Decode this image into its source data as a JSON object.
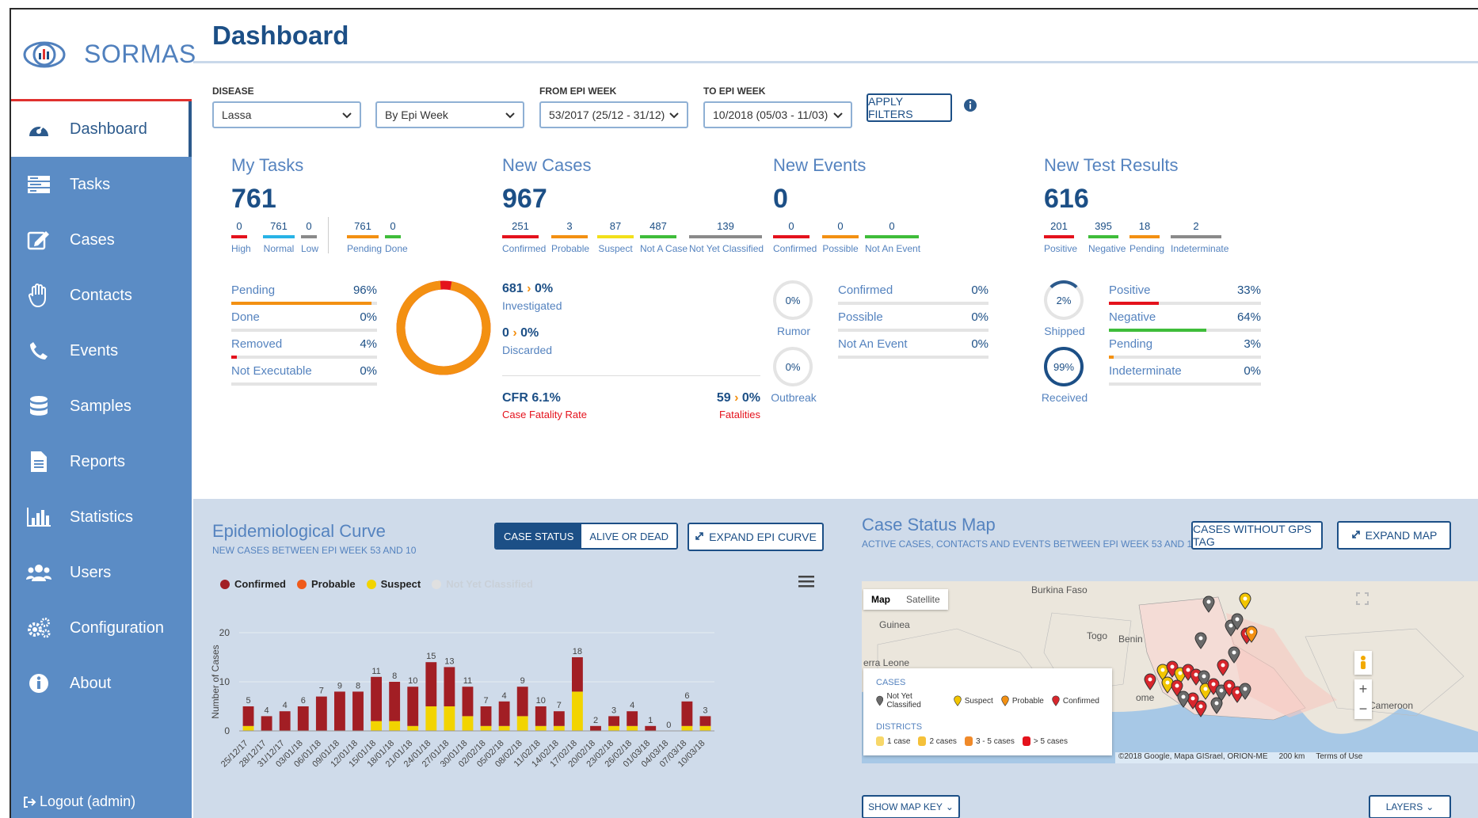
{
  "app": {
    "name": "SORMAS"
  },
  "nav": {
    "items": [
      {
        "label": "Dashboard",
        "icon": "dashboard-icon"
      },
      {
        "label": "Tasks",
        "icon": "tasks-icon"
      },
      {
        "label": "Cases",
        "icon": "edit-icon"
      },
      {
        "label": "Contacts",
        "icon": "hand-icon"
      },
      {
        "label": "Events",
        "icon": "phone-icon"
      },
      {
        "label": "Samples",
        "icon": "database-icon"
      },
      {
        "label": "Reports",
        "icon": "document-icon"
      },
      {
        "label": "Statistics",
        "icon": "bar-chart-icon"
      },
      {
        "label": "Users",
        "icon": "users-icon"
      },
      {
        "label": "Configuration",
        "icon": "gears-icon"
      },
      {
        "label": "About",
        "icon": "info-icon"
      }
    ],
    "logout": "Logout (admin)"
  },
  "header": {
    "title": "Dashboard"
  },
  "filters": {
    "disease_label": "DISEASE",
    "disease_value": "Lassa",
    "grouping_value": "By Epi Week",
    "from_label": "FROM EPI WEEK",
    "from_value": "53/2017 (25/12 - 31/12)",
    "to_label": "TO EPI WEEK",
    "to_value": "10/2018 (05/03 - 11/03)",
    "apply_label": "APPLY FILTERS"
  },
  "tasks": {
    "title": "My Tasks",
    "total": "761",
    "minis": [
      {
        "v": "0",
        "l": "High",
        "c": "#e4121c"
      },
      {
        "v": "761",
        "l": "Normal",
        "c": "#28b3e6"
      },
      {
        "v": "0",
        "l": "Low",
        "c": "#8a8a8a"
      },
      {
        "v": "761",
        "l": "Pending",
        "c": "#f39012"
      },
      {
        "v": "0",
        "l": "Done",
        "c": "#3fbd3a"
      }
    ],
    "progress": [
      {
        "label": "Pending",
        "pct": "96%",
        "fill": 96,
        "c": "#f39012"
      },
      {
        "label": "Done",
        "pct": "0%",
        "fill": 0,
        "c": "#3fbd3a"
      },
      {
        "label": "Removed",
        "pct": "4%",
        "fill": 4,
        "c": "#e4121c"
      },
      {
        "label": "Not Executable",
        "pct": "0%",
        "fill": 0,
        "c": "#8a8a8a"
      }
    ],
    "donut_pending_pct": 96
  },
  "cases": {
    "title": "New Cases",
    "total": "967",
    "minis": [
      {
        "v": "251",
        "l": "Confirmed",
        "c": "#e4121c"
      },
      {
        "v": "3",
        "l": "Probable",
        "c": "#f39012"
      },
      {
        "v": "87",
        "l": "Suspect",
        "c": "#f2e01a"
      },
      {
        "v": "487",
        "l": "Not A Case",
        "c": "#3fbd3a"
      },
      {
        "v": "139",
        "l": "Not Yet Classified",
        "c": "#8a8a8a"
      }
    ],
    "investigated_value": "681",
    "investigated_pct": "0%",
    "investigated_label": "Investigated",
    "discarded_value": "0",
    "discarded_pct": "0%",
    "discarded_label": "Discarded",
    "cfr_value": "CFR 6.1%",
    "cfr_label": "Case Fatality Rate",
    "fatalities_value": "59",
    "fatalities_pct": "0%",
    "fatalities_label": "Fatalities"
  },
  "events": {
    "title": "New Events",
    "total": "0",
    "minis": [
      {
        "v": "0",
        "l": "Confirmed",
        "c": "#e4121c"
      },
      {
        "v": "0",
        "l": "Possible",
        "c": "#f39012"
      },
      {
        "v": "0",
        "l": "Not An Event",
        "c": "#3fbd3a"
      }
    ],
    "rumor_pct": "0%",
    "rumor_label": "Rumor",
    "outbreak_pct": "0%",
    "outbreak_label": "Outbreak",
    "progress": [
      {
        "label": "Confirmed",
        "pct": "0%",
        "fill": 0,
        "c": "#e4121c"
      },
      {
        "label": "Possible",
        "pct": "0%",
        "fill": 0,
        "c": "#f39012"
      },
      {
        "label": "Not An Event",
        "pct": "0%",
        "fill": 0,
        "c": "#3fbd3a"
      }
    ]
  },
  "tests": {
    "title": "New Test Results",
    "total": "616",
    "minis": [
      {
        "v": "201",
        "l": "Positive",
        "c": "#e4121c"
      },
      {
        "v": "395",
        "l": "Negative",
        "c": "#3fbd3a"
      },
      {
        "v": "18",
        "l": "Pending",
        "c": "#f39012"
      },
      {
        "v": "2",
        "l": "Indeterminate",
        "c": "#8a8a8a"
      }
    ],
    "shipped_pct": "2%",
    "shipped_label": "Shipped",
    "received_pct": "99%",
    "received_label": "Received",
    "progress": [
      {
        "label": "Positive",
        "pct": "33%",
        "fill": 33,
        "c": "#e4121c"
      },
      {
        "label": "Negative",
        "pct": "64%",
        "fill": 64,
        "c": "#3fbd3a"
      },
      {
        "label": "Pending",
        "pct": "3%",
        "fill": 3,
        "c": "#f39012"
      },
      {
        "label": "Indeterminate",
        "pct": "0%",
        "fill": 0,
        "c": "#8a8a8a"
      }
    ]
  },
  "epi": {
    "title": "Epidemiological Curve",
    "subtitle": "NEW CASES BETWEEN EPI WEEK 53 AND 10",
    "toggle_a": "CASE STATUS",
    "toggle_b": "ALIVE OR DEAD",
    "expand_label": "EXPAND EPI CURVE",
    "legend": [
      {
        "name": "Confirmed",
        "c": "#a21e24"
      },
      {
        "name": "Probable",
        "c": "#f05a1a"
      },
      {
        "name": "Suspect",
        "c": "#f2d400"
      },
      {
        "name": "Not Yet Classified",
        "c": "#e0e0e0"
      }
    ]
  },
  "chart_data": {
    "type": "bar",
    "ylabel": "Number of Cases",
    "ylim": [
      0,
      20
    ],
    "yticks": [
      "0",
      "10",
      "20"
    ],
    "categories": [
      "25/12/17",
      "28/12/17",
      "31/12/17",
      "03/01/18",
      "06/01/18",
      "09/01/18",
      "12/01/18",
      "15/01/18",
      "18/01/18",
      "21/01/18",
      "24/01/18",
      "27/01/18",
      "30/01/18",
      "02/02/18",
      "05/02/18",
      "08/02/18",
      "11/02/18",
      "14/02/18",
      "17/02/18",
      "20/02/18",
      "23/02/18",
      "26/02/18",
      "01/03/18",
      "04/03/18",
      "07/03/18",
      "10/03/18"
    ],
    "series": [
      {
        "name": "Confirmed",
        "values": [
          4,
          3,
          4,
          5,
          7,
          8,
          8,
          9,
          8,
          8,
          9,
          8,
          6,
          4,
          5,
          6,
          4,
          3,
          7,
          1,
          2,
          3,
          1,
          0,
          5,
          2
        ]
      },
      {
        "name": "Suspect",
        "values": [
          1,
          0,
          0,
          0,
          0,
          0,
          0,
          2,
          2,
          1,
          5,
          5,
          3,
          1,
          1,
          3,
          1,
          1,
          8,
          0,
          1,
          1,
          0,
          0,
          1,
          1
        ]
      }
    ],
    "peak_labels": [
      "5",
      "4",
      "4",
      "6",
      "7",
      "9",
      "8",
      "11",
      "8",
      "10",
      "15",
      "13",
      "11",
      "7",
      "4",
      "9",
      "10",
      "7",
      "18",
      "2",
      "3",
      "4",
      "1",
      "0",
      "6",
      "3"
    ]
  },
  "map": {
    "title": "Case Status Map",
    "subtitle": "ACTIVE CASES, CONTACTS AND EVENTS BETWEEN EPI WEEK 53 AND 10",
    "no_gps_label": "CASES WITHOUT GPS TAG",
    "expand_label": "EXPAND MAP",
    "tab_map": "Map",
    "tab_sat": "Satellite",
    "places": [
      "Burkina Faso",
      "Guinea",
      "Benin",
      "Togo",
      "erra Leone",
      "Cameroon",
      "ome"
    ],
    "key_cases_title": "CASES",
    "key_cases": [
      "Not Yet Classified",
      "Suspect",
      "Probable",
      "Confirmed"
    ],
    "key_districts_title": "DISTRICTS",
    "key_districts": [
      "1 case",
      "2 cases",
      "3 - 5 cases",
      "> 5 cases"
    ],
    "attribution": "©2018 Google, Mapa GISrael, ORION-ME",
    "scale": "200 km",
    "terms": "Terms of Use",
    "show_key_label": "SHOW MAP KEY",
    "layers_label": "LAYERS",
    "colors": {
      "nyc": "#6a6a6a",
      "suspect": "#f2c500",
      "probable": "#f39012",
      "confirmed": "#d8262c"
    }
  }
}
